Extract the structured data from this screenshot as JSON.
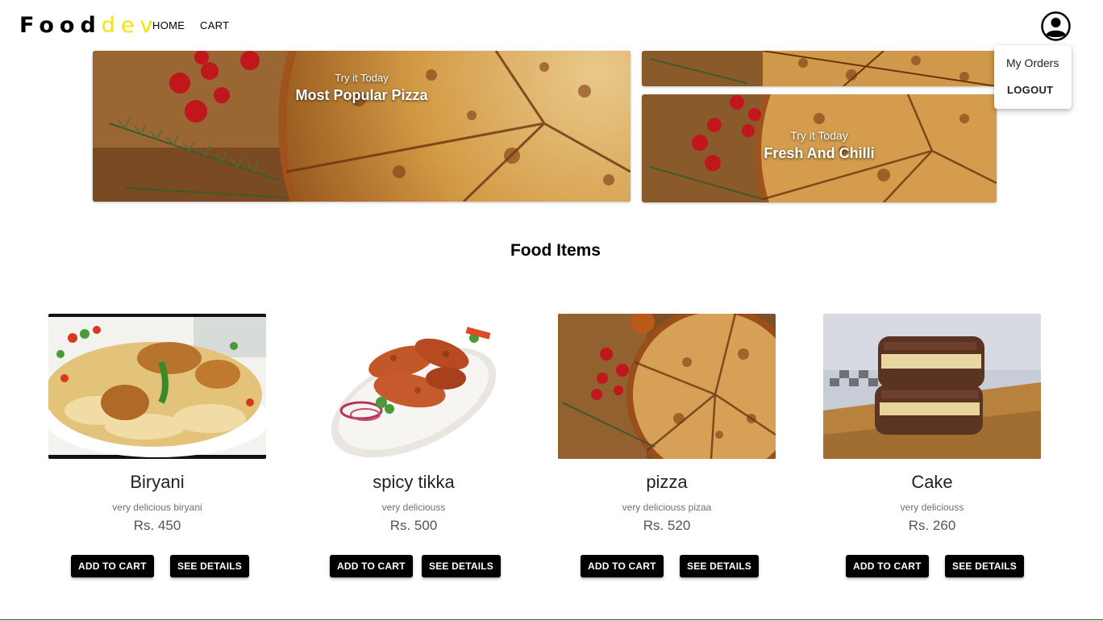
{
  "header": {
    "logo_part1": "Food",
    "logo_part2": "dev",
    "nav": {
      "home": "HOME",
      "cart": "CART"
    }
  },
  "user_menu": {
    "my_orders": "My Orders",
    "logout": "LOGOUT"
  },
  "banners": {
    "main": {
      "tagline": "Try it Today",
      "title": "Most Popular Pizza"
    },
    "secondary": {
      "tagline": "Try it Today",
      "title": "Fresh And Chilli"
    }
  },
  "section_title": "Food Items",
  "buttons": {
    "add_to_cart": "ADD TO CART",
    "see_details": "SEE DETAILS"
  },
  "items": [
    {
      "name": "Biryani",
      "description": "very delicious biryani",
      "price": "Rs. 450"
    },
    {
      "name": "spicy tikka",
      "description": "very deliciouss",
      "price": "Rs. 500"
    },
    {
      "name": "pizza",
      "description": "very deliciouss pizaa",
      "price": "Rs. 520"
    },
    {
      "name": "Cake",
      "description": "very deliciouss",
      "price": "Rs. 260"
    }
  ],
  "colors": {
    "logo_accent": "#f5e400",
    "button_bg": "#000000",
    "button_text": "#ffffff"
  }
}
